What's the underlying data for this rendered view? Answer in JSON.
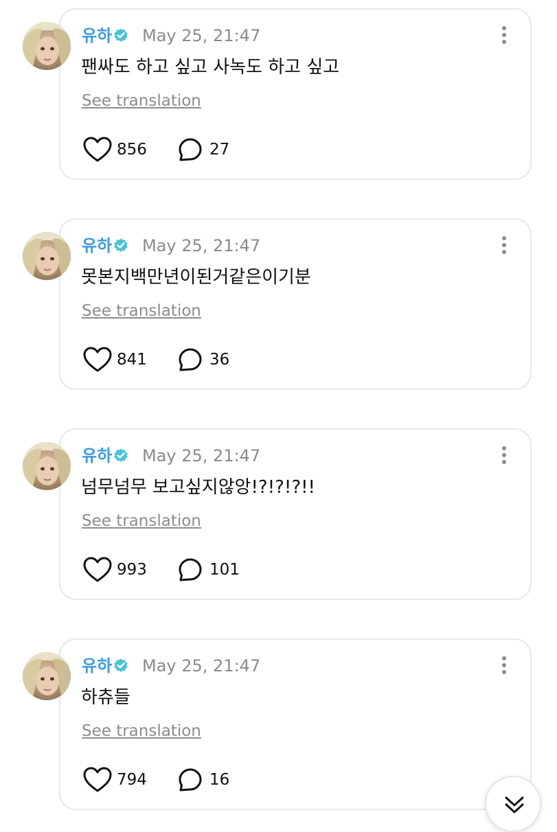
{
  "posts": [
    {
      "author": "유하",
      "time": "May 25, 21:47",
      "text": "팬싸도 하고 싶고 사녹도 하고 싶고",
      "translate_label": "See translation",
      "likes": "856",
      "replies": "27"
    },
    {
      "author": "유하",
      "time": "May 25, 21:47",
      "text": "못본지백만년이된거같은이기분",
      "translate_label": "See translation",
      "likes": "841",
      "replies": "36"
    },
    {
      "author": "유하",
      "time": "May 25, 21:47",
      "text": "넘무넘무 보고싶지않앙!?!?!?!!",
      "translate_label": "See translation",
      "likes": "993",
      "replies": "101"
    },
    {
      "author": "유하",
      "time": "May 25, 21:47",
      "text": "하츄들",
      "translate_label": "See translation",
      "likes": "794",
      "replies": "16"
    }
  ],
  "colors": {
    "author": "#3d9be0",
    "verified": "#4cc2d6",
    "muted": "#8a8a8e",
    "border": "#e8e8ec"
  },
  "icons": {
    "verified": "verified-badge-icon",
    "more": "more-vertical-icon",
    "like": "heart-icon",
    "reply": "comment-bubble-icon",
    "scroll": "double-chevron-down-icon"
  }
}
